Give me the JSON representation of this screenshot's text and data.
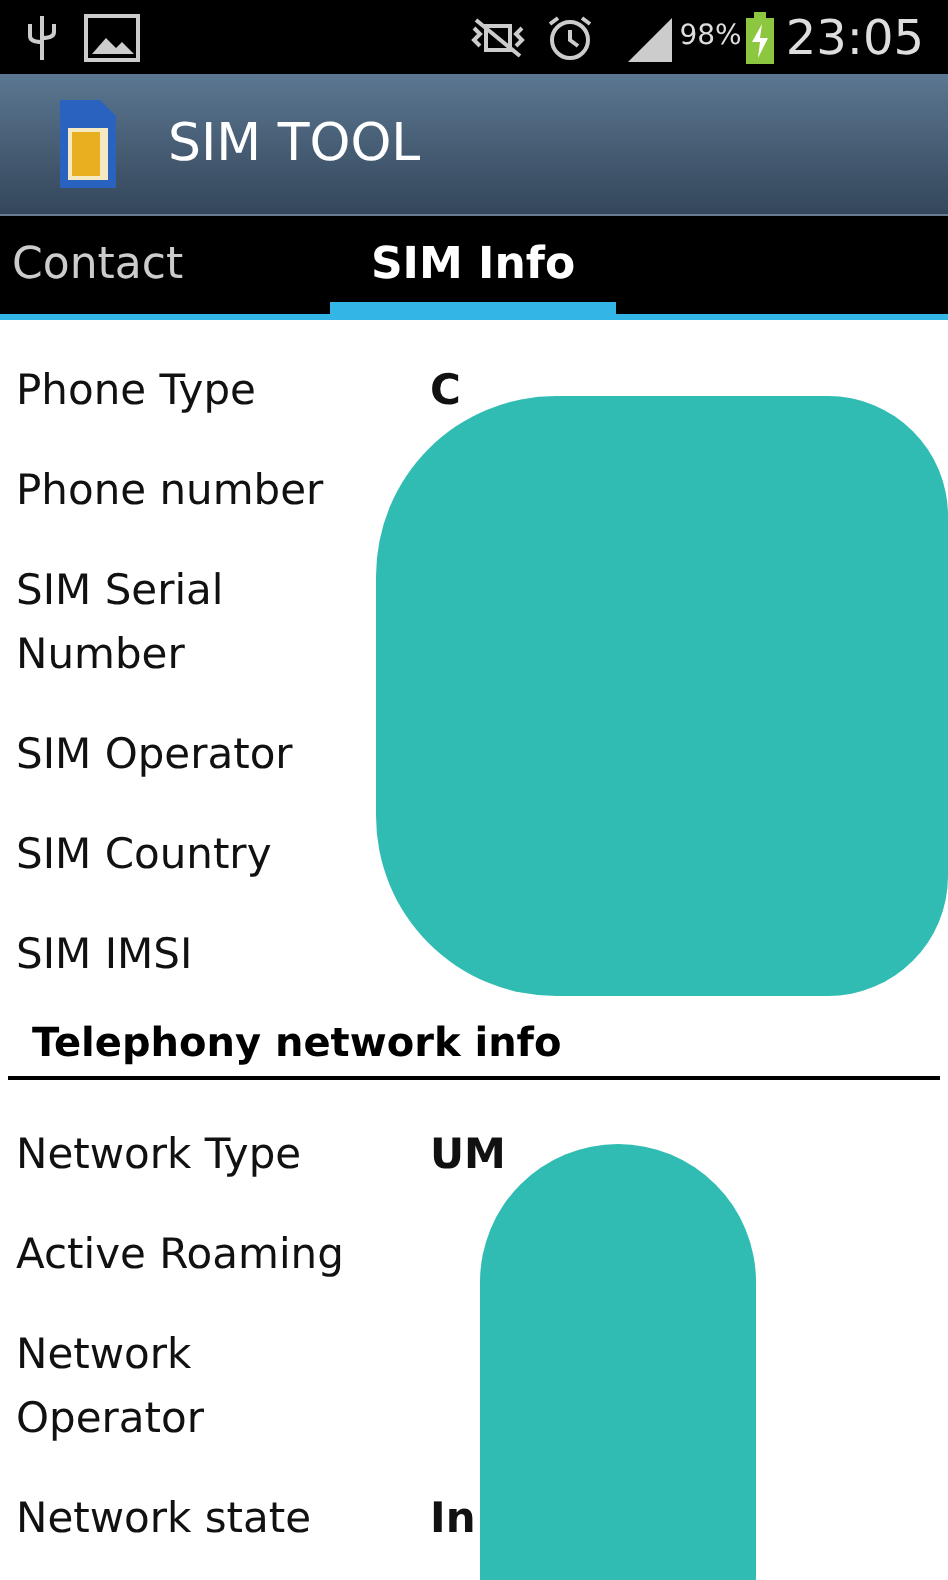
{
  "status_bar": {
    "battery": "98%",
    "time": "23:05"
  },
  "action_bar": {
    "title": "SIM TOOL"
  },
  "tabs": [
    {
      "label": "Contact",
      "selected": false
    },
    {
      "label": "SIM Info",
      "selected": true
    }
  ],
  "sim_info": [
    {
      "label": "Phone Type",
      "value": "C"
    },
    {
      "label": "Phone number"
    },
    {
      "label": "SIM Serial Number"
    },
    {
      "label": "SIM Operator"
    },
    {
      "label": "SIM Country"
    },
    {
      "label": "SIM IMSI"
    }
  ],
  "network_section": {
    "title": "Telephony network info",
    "rows": [
      {
        "label": "Network Type",
        "value": "UM"
      },
      {
        "label": "Active Roaming"
      },
      {
        "label": "Network Operator"
      },
      {
        "label": "Network state",
        "value": "In"
      }
    ]
  }
}
